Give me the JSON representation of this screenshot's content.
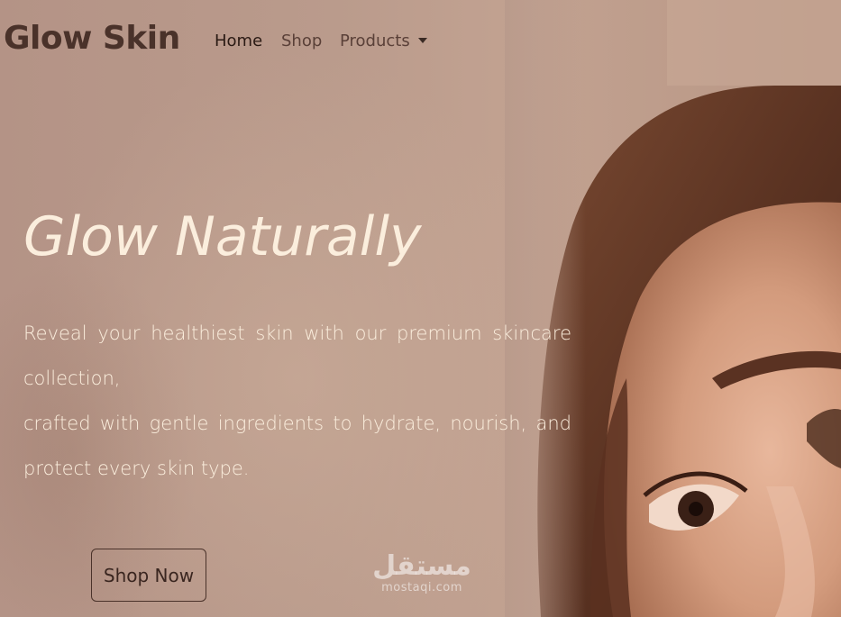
{
  "navbar": {
    "brand": "Glow Skin",
    "items": [
      {
        "label": "Home",
        "active": true
      },
      {
        "label": "Shop",
        "active": false
      },
      {
        "label": "Products",
        "active": false,
        "dropdown": true
      }
    ]
  },
  "hero": {
    "title": "Glow Naturally",
    "text_lines": [
      "Reveal your healthiest skin with our premium skincare",
      "collection,",
      "crafted with gentle ingredients to hydrate, nourish, and",
      "protect every skin type."
    ],
    "button_label": "Shop Now"
  },
  "watermark": {
    "logo": "مستقل",
    "text": "mostaqi.com"
  },
  "colors": {
    "brand": "#4a322a",
    "hero_text": "#fbeedd",
    "background": "#b9998a"
  }
}
